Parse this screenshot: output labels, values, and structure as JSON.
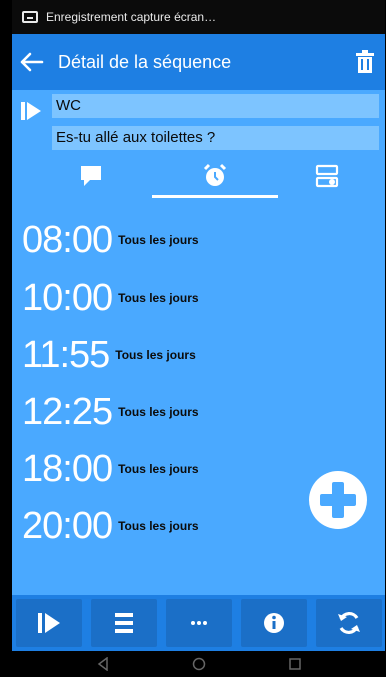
{
  "status_bar": {
    "text": "Enregistrement capture écran…"
  },
  "header": {
    "title": "Détail de la séquence"
  },
  "sequence": {
    "name": "WC",
    "question": "Es-tu allé aux toilettes ?"
  },
  "tabs": [
    {
      "icon": "speech-bubble-icon"
    },
    {
      "icon": "alarm-clock-icon",
      "active": true
    },
    {
      "icon": "sequence-settings-icon"
    }
  ],
  "alarms": [
    {
      "time": "08:00",
      "repeat": "Tous les jours"
    },
    {
      "time": "10:00",
      "repeat": "Tous les jours"
    },
    {
      "time": "11:55",
      "repeat": "Tous les jours"
    },
    {
      "time": "12:25",
      "repeat": "Tous les jours"
    },
    {
      "time": "18:00",
      "repeat": "Tous les jours"
    },
    {
      "time": "20:00",
      "repeat": "Tous les jours"
    }
  ],
  "toolbar": {
    "buttons": [
      {
        "icon": "play-icon"
      },
      {
        "icon": "list-icon"
      },
      {
        "icon": "more-icon"
      },
      {
        "icon": "info-icon"
      },
      {
        "icon": "refresh-icon"
      }
    ]
  },
  "colors": {
    "header": "#1e7fe3",
    "content": "#4aa9ff",
    "field": "#7dc4ff"
  }
}
